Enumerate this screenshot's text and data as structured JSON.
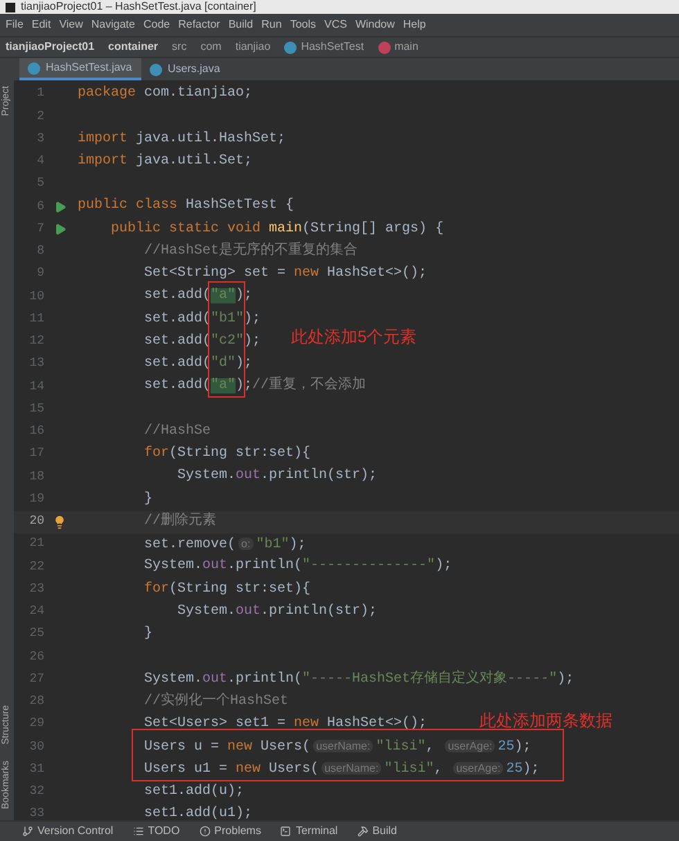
{
  "window": {
    "title": "tianjiaoProject01 – HashSetTest.java [container]"
  },
  "menu": [
    "File",
    "Edit",
    "View",
    "Navigate",
    "Code",
    "Refactor",
    "Build",
    "Run",
    "Tools",
    "VCS",
    "Window",
    "Help"
  ],
  "breadcrumb": [
    {
      "kind": "project",
      "label": "tianjiaoProject01"
    },
    {
      "kind": "project",
      "label": "container"
    },
    {
      "kind": "folder",
      "label": "src"
    },
    {
      "kind": "folder",
      "label": "com"
    },
    {
      "kind": "folder",
      "label": "tianjiao"
    },
    {
      "kind": "class",
      "label": "HashSetTest"
    },
    {
      "kind": "method",
      "label": "main"
    }
  ],
  "tabs": [
    {
      "label": "HashSetTest.java",
      "selected": true
    },
    {
      "label": "Users.java",
      "selected": false
    }
  ],
  "side_tools": {
    "top": [
      "Project"
    ],
    "bottom": [
      "Structure",
      "Bookmarks"
    ]
  },
  "lines": [
    {
      "number": "1",
      "current": false,
      "tokens": [
        {
          "kind": "kw",
          "text": "package"
        },
        {
          "kind": "pl",
          "text": " com.tianjiao;"
        }
      ]
    },
    {
      "number": "2",
      "current": false
    },
    {
      "number": "3",
      "current": false,
      "tokens": [
        {
          "kind": "kw",
          "text": "import"
        },
        {
          "kind": "pl",
          "text": " java.util.HashSet;"
        }
      ]
    },
    {
      "number": "4",
      "current": false,
      "tokens": [
        {
          "kind": "kw",
          "text": "import"
        },
        {
          "kind": "pl",
          "text": " java.util.Set;"
        }
      ]
    },
    {
      "number": "5",
      "current": false
    },
    {
      "number": "6",
      "current": false,
      "run_icon": true,
      "tokens": [
        {
          "kind": "kw",
          "text": "public class"
        },
        {
          "kind": "pl",
          "text": " HashSetTest {"
        }
      ]
    },
    {
      "number": "7",
      "current": false,
      "run_icon": true,
      "tokens": [
        {
          "kind": "kw",
          "text": "    public static void "
        },
        {
          "kind": "method",
          "text": "main"
        },
        {
          "kind": "pl",
          "text": "(String[] args) {"
        }
      ]
    },
    {
      "number": "8",
      "current": false,
      "tokens": [
        {
          "kind": "com",
          "text": "        //HashSet是无序的不重复的集合"
        }
      ]
    },
    {
      "number": "9",
      "current": false,
      "tokens": [
        {
          "kind": "pl",
          "text": "        Set<String> set = "
        },
        {
          "kind": "kw",
          "text": "new"
        },
        {
          "kind": "pl",
          "text": " HashSet<>();"
        }
      ]
    },
    {
      "number": "10",
      "current": false,
      "tokens": [
        {
          "kind": "pl",
          "text": "        set.add("
        },
        {
          "kind": "match",
          "text": "\"a\""
        },
        {
          "kind": "pl",
          "text": ");"
        }
      ]
    },
    {
      "number": "11",
      "current": false,
      "tokens": [
        {
          "kind": "pl",
          "text": "        set.add("
        },
        {
          "kind": "str",
          "text": "\"b1\""
        },
        {
          "kind": "pl",
          "text": ");"
        }
      ]
    },
    {
      "number": "12",
      "current": false,
      "tokens": [
        {
          "kind": "pl",
          "text": "        set.add("
        },
        {
          "kind": "str",
          "text": "\"c2\""
        },
        {
          "kind": "pl",
          "text": ");"
        }
      ]
    },
    {
      "number": "13",
      "current": false,
      "tokens": [
        {
          "kind": "pl",
          "text": "        set.add("
        },
        {
          "kind": "str",
          "text": "\"d\""
        },
        {
          "kind": "pl",
          "text": ");"
        }
      ]
    },
    {
      "number": "14",
      "current": false,
      "tokens": [
        {
          "kind": "pl",
          "text": "        set.add("
        },
        {
          "kind": "match",
          "text": "\"a\""
        },
        {
          "kind": "pl",
          "text": ");"
        },
        {
          "kind": "com",
          "text": "//重复，不会添加"
        }
      ]
    },
    {
      "number": "15",
      "current": false
    },
    {
      "number": "16",
      "current": false,
      "tokens": [
        {
          "kind": "com",
          "text": "        //HashSe"
        }
      ]
    },
    {
      "number": "17",
      "current": false,
      "tokens": [
        {
          "kind": "kw",
          "text": "        for"
        },
        {
          "kind": "pl",
          "text": "(String str:set){"
        }
      ]
    },
    {
      "number": "18",
      "current": false,
      "tokens": [
        {
          "kind": "pl",
          "text": "            System."
        },
        {
          "kind": "field",
          "text": "out"
        },
        {
          "kind": "pl",
          "text": ".println(str);"
        }
      ]
    },
    {
      "number": "19",
      "current": false,
      "tokens": [
        {
          "kind": "pl",
          "text": "        }"
        }
      ]
    },
    {
      "number": "20",
      "current": true,
      "bulb_icon": true,
      "tokens": [
        {
          "kind": "com",
          "text": "        //删除元素"
        }
      ]
    },
    {
      "number": "21",
      "current": false,
      "tokens": [
        {
          "kind": "pl",
          "text": "        set.remove("
        },
        {
          "kind": "hint",
          "text": "o:"
        },
        {
          "kind": "str",
          "text": "\"b1\""
        },
        {
          "kind": "pl",
          "text": ");"
        }
      ]
    },
    {
      "number": "22",
      "current": false,
      "tokens": [
        {
          "kind": "pl",
          "text": "        System."
        },
        {
          "kind": "field",
          "text": "out"
        },
        {
          "kind": "pl",
          "text": ".println("
        },
        {
          "kind": "str",
          "text": "\"--------------\""
        },
        {
          "kind": "pl",
          "text": ");"
        }
      ]
    },
    {
      "number": "23",
      "current": false,
      "tokens": [
        {
          "kind": "kw",
          "text": "        for"
        },
        {
          "kind": "pl",
          "text": "(String str:set){"
        }
      ]
    },
    {
      "number": "24",
      "current": false,
      "tokens": [
        {
          "kind": "pl",
          "text": "            System."
        },
        {
          "kind": "field",
          "text": "out"
        },
        {
          "kind": "pl",
          "text": ".println(str);"
        }
      ]
    },
    {
      "number": "25",
      "current": false,
      "tokens": [
        {
          "kind": "pl",
          "text": "        }"
        }
      ]
    },
    {
      "number": "26",
      "current": false
    },
    {
      "number": "27",
      "current": false,
      "tokens": [
        {
          "kind": "pl",
          "text": "        System."
        },
        {
          "kind": "field",
          "text": "out"
        },
        {
          "kind": "pl",
          "text": ".println("
        },
        {
          "kind": "str",
          "text": "\"-----HashSet存储自定义对象-----\""
        },
        {
          "kind": "pl",
          "text": ");"
        }
      ]
    },
    {
      "number": "28",
      "current": false,
      "tokens": [
        {
          "kind": "com",
          "text": "        //实例化一个HashSet"
        }
      ]
    },
    {
      "number": "29",
      "current": false,
      "tokens": [
        {
          "kind": "pl",
          "text": "        Set<Users> set1 = "
        },
        {
          "kind": "kw",
          "text": "new"
        },
        {
          "kind": "pl",
          "text": " HashSet<>();"
        }
      ]
    },
    {
      "number": "30",
      "current": false,
      "tokens": [
        {
          "kind": "pl",
          "text": "        Users u = "
        },
        {
          "kind": "kw",
          "text": "new"
        },
        {
          "kind": "pl",
          "text": " Users("
        },
        {
          "kind": "hint",
          "text": "userName:"
        },
        {
          "kind": "str",
          "text": "\"lisi\""
        },
        {
          "kind": "pl",
          "text": ", "
        },
        {
          "kind": "hint",
          "text": "userAge:"
        },
        {
          "kind": "num",
          "text": "25"
        },
        {
          "kind": "pl",
          "text": ");"
        }
      ]
    },
    {
      "number": "31",
      "current": false,
      "tokens": [
        {
          "kind": "pl",
          "text": "        Users u1 = "
        },
        {
          "kind": "kw",
          "text": "new"
        },
        {
          "kind": "pl",
          "text": " Users("
        },
        {
          "kind": "hint",
          "text": "userName:"
        },
        {
          "kind": "str",
          "text": "\"lisi\""
        },
        {
          "kind": "pl",
          "text": ", "
        },
        {
          "kind": "hint",
          "text": "userAge:"
        },
        {
          "kind": "num",
          "text": "25"
        },
        {
          "kind": "pl",
          "text": ");"
        }
      ]
    },
    {
      "number": "32",
      "current": false,
      "tokens": [
        {
          "kind": "pl",
          "text": "        set1.add(u);"
        }
      ]
    },
    {
      "number": "33",
      "current": false,
      "tokens": [
        {
          "kind": "pl",
          "text": "        set1.add(u1);"
        }
      ]
    }
  ],
  "annotations": [
    {
      "label": "此处添加5个元素"
    },
    {
      "label": "此处添加两条数据"
    }
  ],
  "status_bar": [
    "Version Control",
    "TODO",
    "Problems",
    "Terminal",
    "Build"
  ]
}
